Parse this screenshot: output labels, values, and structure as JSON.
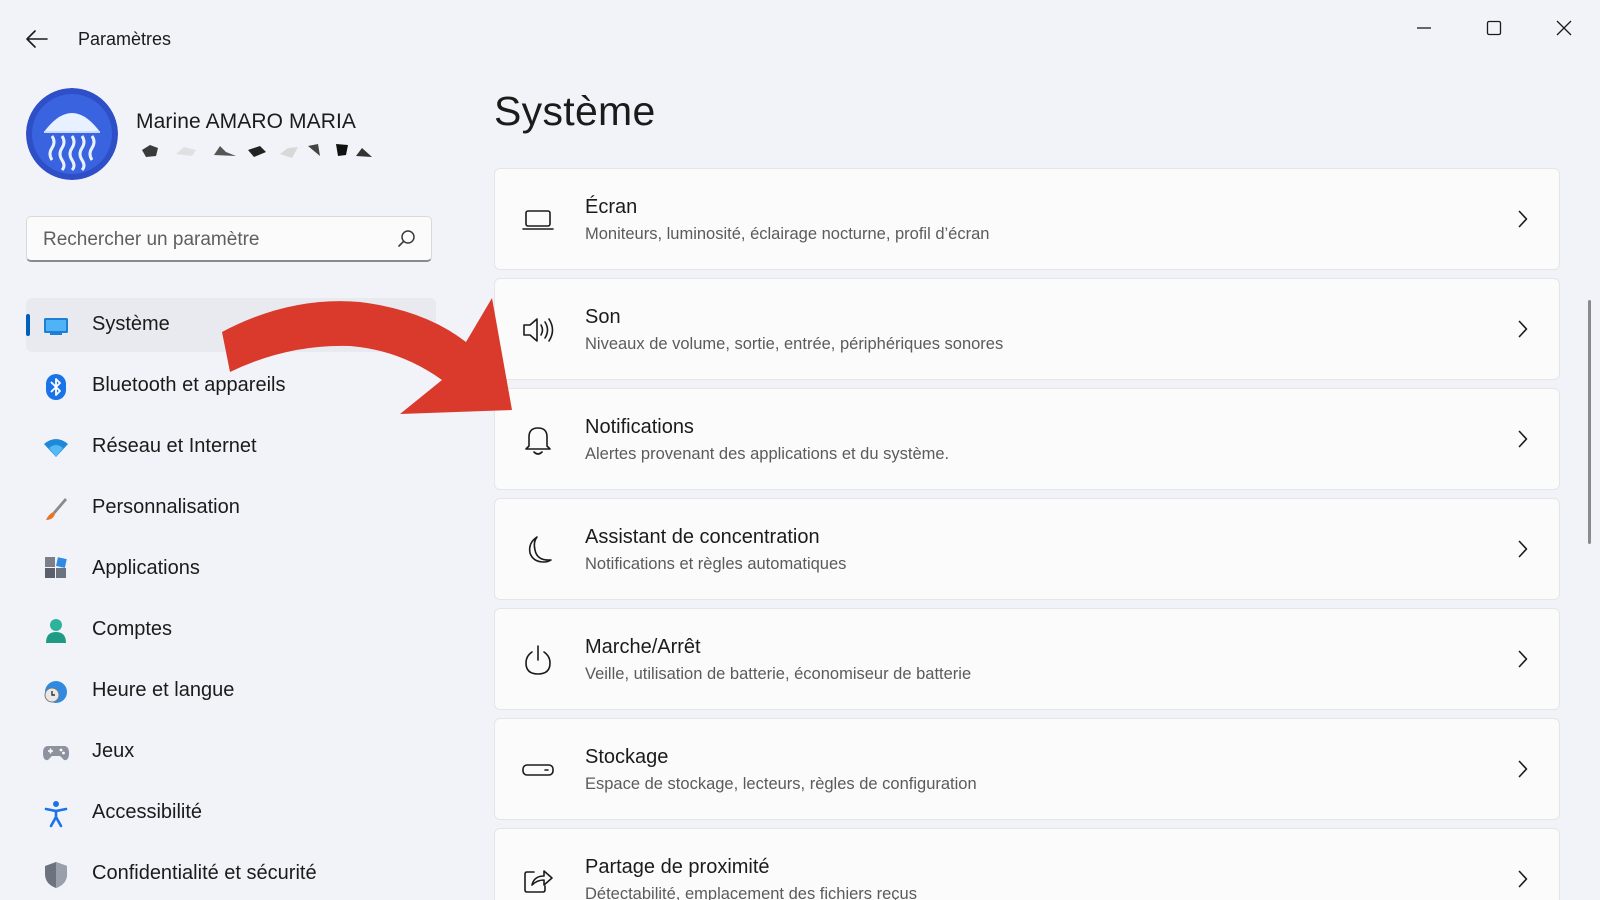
{
  "window": {
    "title": "Paramètres",
    "controls": {
      "minimize": "minimize",
      "maximize": "maximize",
      "close": "close"
    }
  },
  "profile": {
    "name": "Marine AMARO MARIA"
  },
  "search": {
    "placeholder": "Rechercher un paramètre",
    "value": ""
  },
  "sidebar": {
    "items": [
      {
        "label": "Système",
        "icon": "system-icon",
        "active": true
      },
      {
        "label": "Bluetooth et appareils",
        "icon": "bluetooth-icon"
      },
      {
        "label": "Réseau et Internet",
        "icon": "wifi-icon"
      },
      {
        "label": "Personnalisation",
        "icon": "brush-icon"
      },
      {
        "label": "Applications",
        "icon": "apps-icon"
      },
      {
        "label": "Comptes",
        "icon": "account-icon"
      },
      {
        "label": "Heure et langue",
        "icon": "time-language-icon"
      },
      {
        "label": "Jeux",
        "icon": "gamepad-icon"
      },
      {
        "label": "Accessibilité",
        "icon": "accessibility-icon"
      },
      {
        "label": "Confidentialité et sécurité",
        "icon": "shield-icon"
      }
    ]
  },
  "main": {
    "title": "Système",
    "cards": [
      {
        "title": "Écran",
        "subtitle": "Moniteurs, luminosité, éclairage nocturne, profil d’écran",
        "icon": "display-icon"
      },
      {
        "title": "Son",
        "subtitle": "Niveaux de volume, sortie, entrée, périphériques sonores",
        "icon": "speaker-icon"
      },
      {
        "title": "Notifications",
        "subtitle": "Alertes provenant des applications et du système.",
        "icon": "bell-icon"
      },
      {
        "title": "Assistant de concentration",
        "subtitle": "Notifications et règles automatiques",
        "icon": "moon-icon"
      },
      {
        "title": "Marche/Arrêt",
        "subtitle": "Veille, utilisation de batterie, économiseur de batterie",
        "icon": "power-icon"
      },
      {
        "title": "Stockage",
        "subtitle": "Espace de stockage, lecteurs, règles de configuration",
        "icon": "storage-icon"
      },
      {
        "title": "Partage de proximité",
        "subtitle": "Détectabilité, emplacement des fichiers reçus",
        "icon": "share-icon"
      }
    ]
  },
  "colors": {
    "accent": "#005fb8",
    "arrow": "#d93a2b",
    "background": "#f2f3f8",
    "card": "#fbfbfb"
  }
}
